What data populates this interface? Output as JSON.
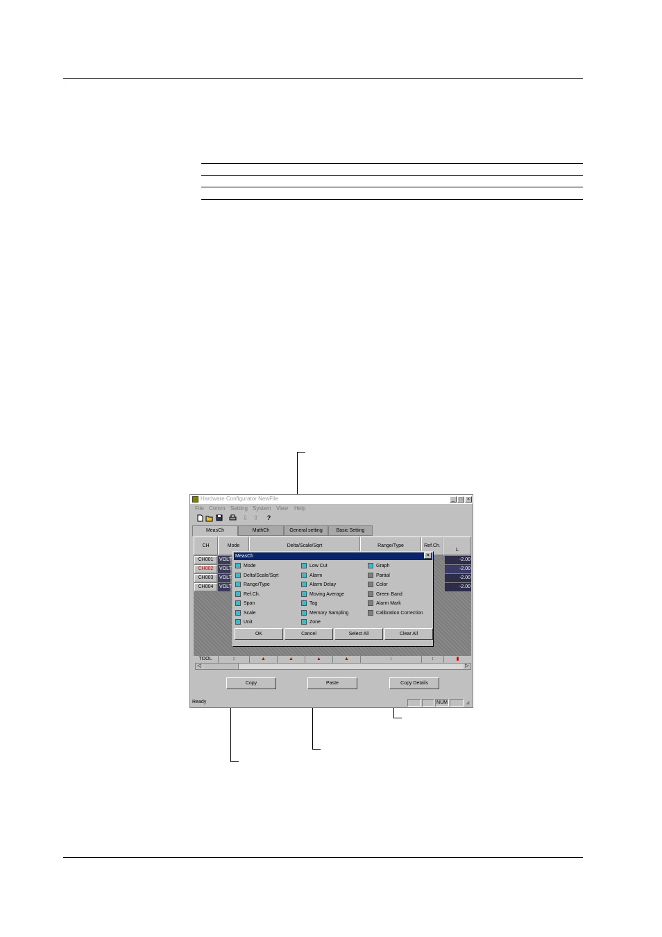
{
  "app": {
    "window_title": "Hardware Configurator NewFile",
    "caption_buttons": [
      "_",
      "□",
      "×"
    ],
    "menus": [
      "File",
      "Comm",
      "Setting",
      "System",
      "View",
      "Help"
    ],
    "toolbar_icons": [
      "new-icon",
      "open-icon",
      "save-icon",
      "print-icon",
      "receive-icon",
      "send-icon",
      "help-icon"
    ],
    "tabs": [
      "MeasCh",
      "MathCh",
      "General setting",
      "Basic Setting"
    ],
    "grid": {
      "columns": [
        "CH",
        "Mode",
        "Delta/Scale/Sqrt",
        "Range/Type",
        "Ref.Ch.",
        "L"
      ],
      "rows": [
        {
          "ch": "CH001",
          "mode": "VOLT",
          "value": "-2.00",
          "highlight": false
        },
        {
          "ch": "CH002",
          "mode": "VOLT",
          "value": "-2.00",
          "highlight": true
        },
        {
          "ch": "CH003",
          "mode": "VOLT",
          "value": "-2.00",
          "highlight": false
        },
        {
          "ch": "CH004",
          "mode": "VOLT",
          "value": "-2.00",
          "highlight": false
        }
      ],
      "footer_label": "TOOL"
    },
    "buttons": {
      "copy": "Copy",
      "paste": "Paste",
      "copy_details": "Copy Details"
    },
    "status": {
      "text": "Ready",
      "num": "NUM"
    }
  },
  "dialog": {
    "title": "MeasCh",
    "options": [
      {
        "label": "Mode",
        "checked": true
      },
      {
        "label": "Delta/Scale/Sqrt",
        "checked": true
      },
      {
        "label": "Range/Type",
        "checked": true
      },
      {
        "label": "Ref.Ch.",
        "checked": true
      },
      {
        "label": "Span",
        "checked": true
      },
      {
        "label": "Scale",
        "checked": true
      },
      {
        "label": "Unit",
        "checked": true
      },
      {
        "label": "Low Cut",
        "checked": true
      },
      {
        "label": "Alarm",
        "checked": true
      },
      {
        "label": "Alarm Delay",
        "checked": true
      },
      {
        "label": "Moving Average",
        "checked": true
      },
      {
        "label": "Tag",
        "checked": true
      },
      {
        "label": "Memory Sampling",
        "checked": true
      },
      {
        "label": "Zone",
        "checked": true
      },
      {
        "label": "Graph",
        "checked": true
      },
      {
        "label": "Partial",
        "checked": false
      },
      {
        "label": "Color",
        "checked": false
      },
      {
        "label": "Green Band",
        "checked": false
      },
      {
        "label": "Alarm Mark",
        "checked": false
      },
      {
        "label": "Calibration Correction",
        "checked": false
      }
    ],
    "buttons": {
      "ok": "OK",
      "cancel": "Cancel",
      "select_all": "Select All",
      "clear_all": "Clear All"
    }
  },
  "colors": {
    "dialog_title": "#0a246a",
    "checked": "#40b8c8",
    "unchecked": "#808080",
    "highlight_row": "#c00000"
  }
}
